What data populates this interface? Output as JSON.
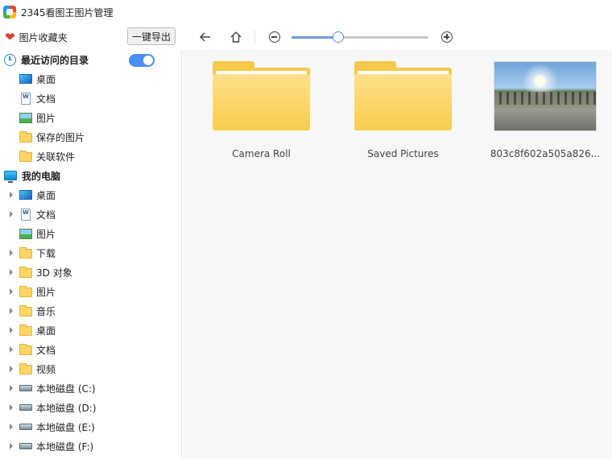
{
  "app": {
    "title": "2345看图王图片管理"
  },
  "toolbar": {
    "favorites_label": "图片收藏夹",
    "export_label": "一键导出",
    "zoom_level": 0.34
  },
  "sidebar": {
    "recent": {
      "header": "最近访问的目录",
      "toggle_on": true,
      "items": [
        {
          "label": "桌面",
          "icon": "desktop-icon"
        },
        {
          "label": "文档",
          "icon": "document-icon"
        },
        {
          "label": "图片",
          "icon": "picture-icon"
        },
        {
          "label": "保存的图片",
          "icon": "folder-icon"
        },
        {
          "label": "关联软件",
          "icon": "folder-icon"
        }
      ]
    },
    "computer": {
      "header": "我的电脑",
      "items": [
        {
          "label": "桌面",
          "icon": "desktop-icon",
          "expandable": true
        },
        {
          "label": "文档",
          "icon": "document-icon",
          "expandable": true
        },
        {
          "label": "图片",
          "icon": "picture-icon",
          "expandable": false
        },
        {
          "label": "下载",
          "icon": "folder-icon",
          "expandable": true
        },
        {
          "label": "3D 对象",
          "icon": "folder-icon",
          "expandable": true
        },
        {
          "label": "图片",
          "icon": "folder-icon",
          "expandable": true
        },
        {
          "label": "音乐",
          "icon": "folder-icon",
          "expandable": true
        },
        {
          "label": "桌面",
          "icon": "folder-icon",
          "expandable": true
        },
        {
          "label": "文档",
          "icon": "folder-icon",
          "expandable": true
        },
        {
          "label": "视频",
          "icon": "folder-icon",
          "expandable": true
        },
        {
          "label": "本地磁盘 (C:)",
          "icon": "drive-icon",
          "expandable": true
        },
        {
          "label": "本地磁盘 (D:)",
          "icon": "drive-icon",
          "expandable": true
        },
        {
          "label": "本地磁盘 (E:)",
          "icon": "drive-icon",
          "expandable": true
        },
        {
          "label": "本地磁盘 (F:)",
          "icon": "drive-icon",
          "expandable": true
        }
      ]
    }
  },
  "main": {
    "tiles": [
      {
        "caption": "Camera Roll",
        "type": "folder"
      },
      {
        "caption": "Saved Pictures",
        "type": "folder"
      },
      {
        "caption": "803c8f602a505a826...",
        "type": "image"
      }
    ]
  }
}
